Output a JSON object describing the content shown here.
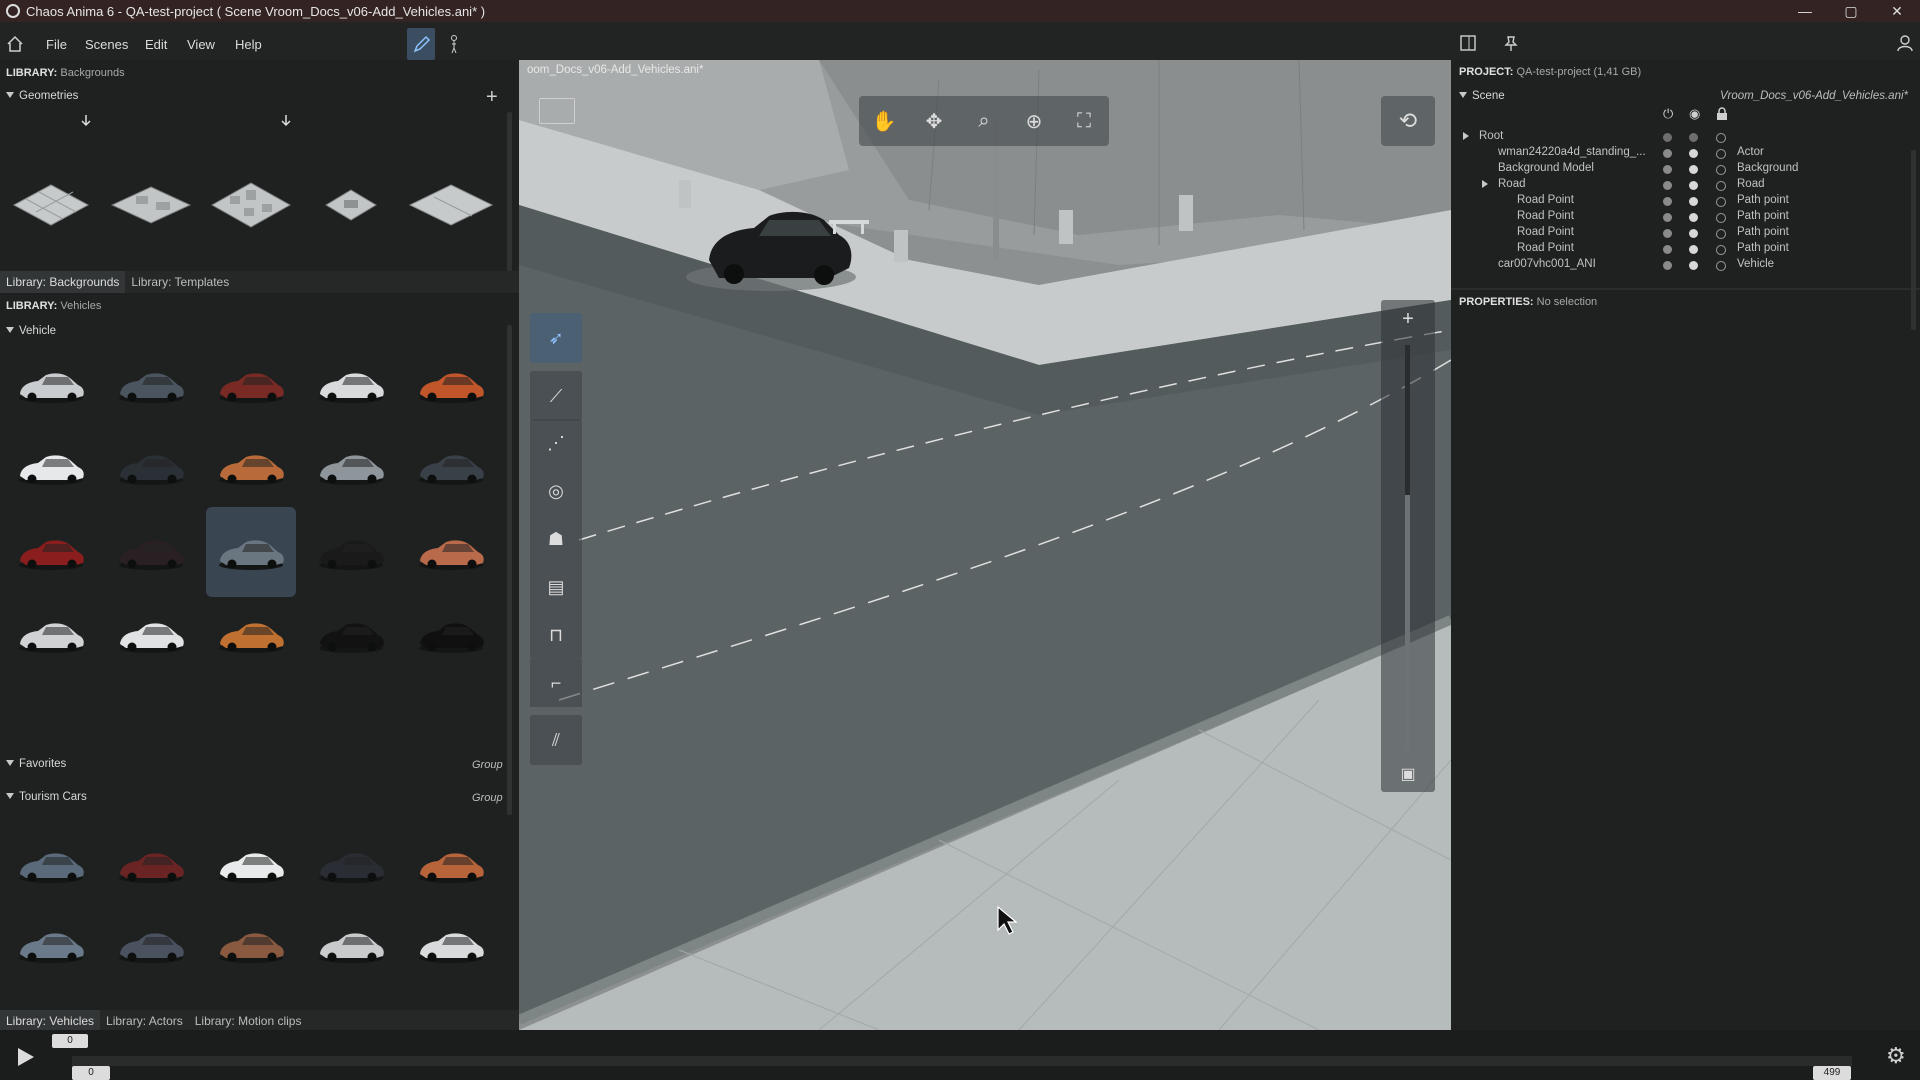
{
  "titlebar": {
    "title": "Chaos Anima 6 -  QA-test-project ( Scene Vroom_Docs_v06-Add_Vehicles.ani* )",
    "minimize": "—",
    "maximize": "▢",
    "close": "✕"
  },
  "menu": {
    "items": [
      "File",
      "Scenes",
      "Edit",
      "View",
      "Help"
    ]
  },
  "library_top": {
    "label": "LIBRARY:",
    "sub": "Backgrounds",
    "section": "Geometries",
    "tabs": [
      "Library: Backgrounds",
      "Library: Templates"
    ]
  },
  "library_vehicles": {
    "label": "LIBRARY:",
    "sub": "Vehicles",
    "section_vehicle": "Vehicle",
    "section_favorites": "Favorites",
    "section_tourism": "Tourism Cars",
    "group_label": "Group",
    "tabs": [
      "Library: Vehicles",
      "Library: Actors",
      "Library: Motion clips"
    ]
  },
  "viewport": {
    "title": "oom_Docs_v06-Add_Vehicles.ani*"
  },
  "project": {
    "label": "PROJECT:",
    "value": "QA-test-project (1,41 GB)",
    "scene_label": "Scene",
    "scene_file": "Vroom_Docs_v06-Add_Vehicles.ani*",
    "tree": [
      {
        "name": "Root",
        "type": ""
      },
      {
        "name": "wman24220a4d_standing_...",
        "type": "Actor"
      },
      {
        "name": "Background Model",
        "type": "Background"
      },
      {
        "name": "Road",
        "type": "Road"
      },
      {
        "name": "Road Point",
        "type": "Path point"
      },
      {
        "name": "Road Point",
        "type": "Path point"
      },
      {
        "name": "Road Point",
        "type": "Path point"
      },
      {
        "name": "Road Point",
        "type": "Path point"
      },
      {
        "name": "car007vhc001_ANI",
        "type": "Vehicle"
      }
    ]
  },
  "properties": {
    "label": "PROPERTIES:",
    "value": "No selection"
  },
  "timeline": {
    "current_frame": "0",
    "start_frame": "0",
    "end_frame": "499"
  },
  "colors": {
    "titlebar": "#332323",
    "accent": "#3b4d60",
    "selection": "#3a4552"
  }
}
